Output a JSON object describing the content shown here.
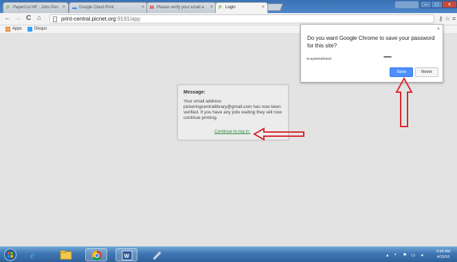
{
  "browser": {
    "tabs": [
      {
        "label": "PaperCut MF : Jobs Pen",
        "favicon": "papercut-icon",
        "active": false
      },
      {
        "label": "Google Cloud Print",
        "favicon": "cloud-print-icon",
        "active": false
      },
      {
        "label": "Please verify your email a",
        "favicon": "gmail-icon",
        "active": false
      },
      {
        "label": "Login",
        "favicon": "papercut-icon",
        "active": true
      }
    ],
    "url_host": "print-central.picnet.org",
    "url_rest": ":9191/app",
    "bookmarks": [
      {
        "label": "Apps",
        "icon": "apps-grid-icon"
      },
      {
        "label": "Disqus",
        "icon": "disqus-icon"
      }
    ]
  },
  "message": {
    "title": "Message:",
    "body": "Your email address pickeringcentrallibrary@gmail.com has now been verified. If you have any jobs waiting they will now continue printing.",
    "link": "Continue to log in."
  },
  "password_bubble": {
    "question": "Do you want Google Chrome to save your password for this site?",
    "username": "m.aymenahmed",
    "password_mask": "••••••••••",
    "save_label": "Save",
    "never_label": "Never"
  },
  "taskbar": {
    "time": "9:58 AM",
    "date": "4/15/16"
  },
  "colors": {
    "annotation": "#d9262d",
    "link": "#2b8a3e",
    "save_button": "#4d90fe"
  }
}
